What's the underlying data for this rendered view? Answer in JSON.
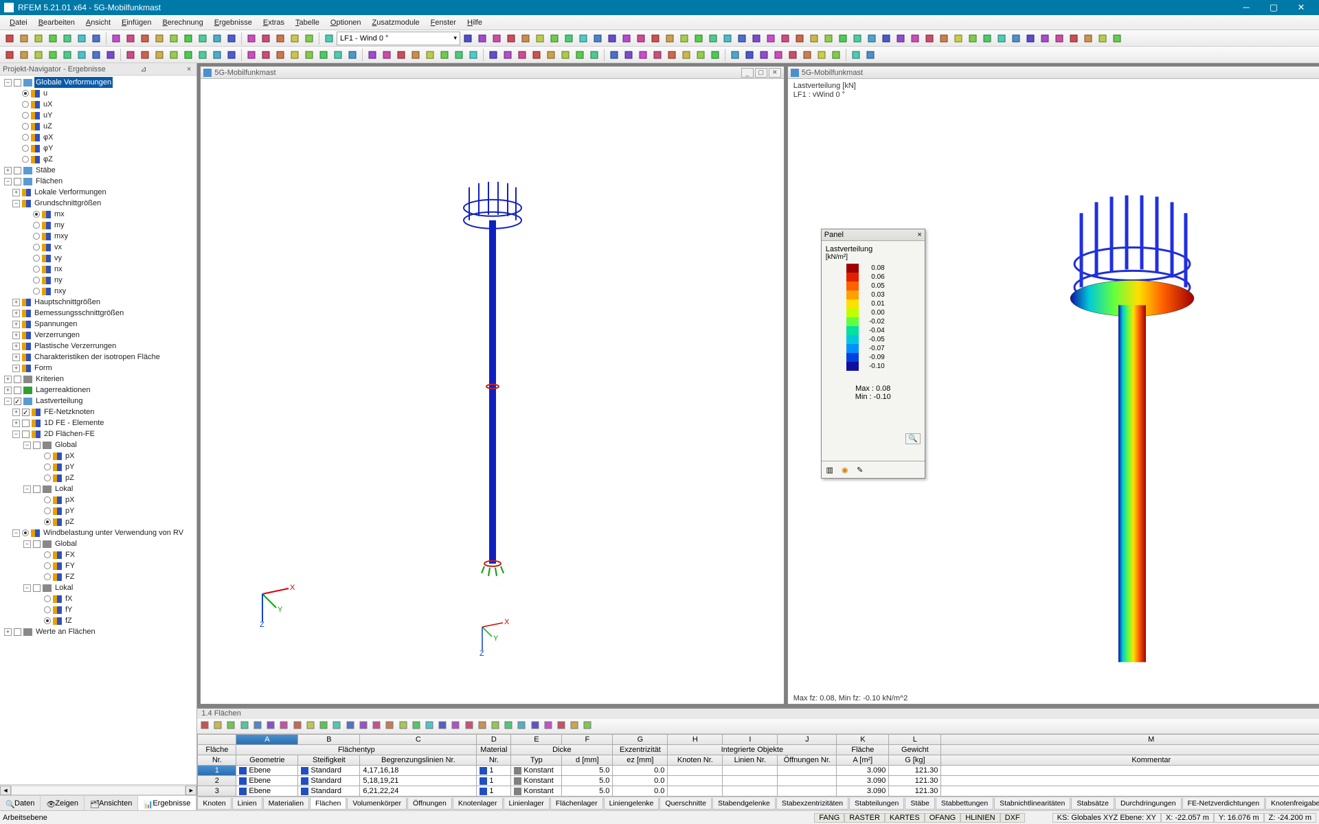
{
  "app": {
    "title": "RFEM 5.21.01 x64 - 5G-Mobilfunkmast"
  },
  "menu": [
    "Datei",
    "Bearbeiten",
    "Ansicht",
    "Einfügen",
    "Berechnung",
    "Ergebnisse",
    "Extras",
    "Tabelle",
    "Optionen",
    "Zusatzmodule",
    "Fenster",
    "Hilfe"
  ],
  "loadcase_combo": "LF1 - Wind 0 °",
  "navigator": {
    "title": "Projekt-Navigator - Ergebnisse",
    "tabs": [
      "Daten",
      "Zeigen",
      "Ansichten",
      "Ergebnisse"
    ],
    "active_tab": 3,
    "tree": {
      "root": "Globale Verformungen",
      "glob_items": [
        "u",
        "uX",
        "uY",
        "uZ",
        "φX",
        "φY",
        "φZ"
      ],
      "staebe": "Stäbe",
      "flaechen": "Flächen",
      "lokale_verf": "Lokale Verformungen",
      "grundschnitt": "Grundschnittgrößen",
      "gs_items": [
        "mx",
        "my",
        "mxy",
        "vx",
        "vy",
        "nx",
        "ny",
        "nxy"
      ],
      "hauptschnitt": "Hauptschnittgrößen",
      "bemessungsschnitt": "Bemessungsschnittgrößen",
      "spannungen": "Spannungen",
      "verzerrungen": "Verzerrungen",
      "plastische": "Plastische Verzerrungen",
      "charakteristiken": "Charakteristiken der isotropen Fläche",
      "form": "Form",
      "kriterien": "Kriterien",
      "lagerreaktionen": "Lagerreaktionen",
      "lastverteilung": "Lastverteilung",
      "fe_netzknoten": "FE-Netzknoten",
      "fe_1d": "1D FE - Elemente",
      "fe_2d": "2D Flächen-FE",
      "global": "Global",
      "px": "pX",
      "py": "pY",
      "pz": "pZ",
      "lokal": "Lokal",
      "windlast": "Windbelastung unter Verwendung von RV",
      "fx": "FX",
      "fy": "FY",
      "fz": "FZ",
      "lfx": "fX",
      "lfy": "fY",
      "lfz": "fZ",
      "werte": "Werte an Flächen"
    }
  },
  "view1": {
    "title": "5G-Mobilfunkmast"
  },
  "view2": {
    "title": "5G-Mobilfunkmast",
    "info_l1": "Lastverteilung [kN]",
    "info_l2": "LF1 : vWind 0 °",
    "foot": "Max fz: 0.08, Min fz: -0.10 kN/m^2"
  },
  "legend": {
    "title": "Panel",
    "heading": "Lastverteilung",
    "unit": "[kN/m²]",
    "values": [
      "0.08",
      "0.06",
      "0.05",
      "0.03",
      "0.01",
      "0.00",
      "-0.02",
      "-0.04",
      "-0.05",
      "-0.07",
      "-0.09",
      "-0.10"
    ],
    "colors": [
      "#a00000",
      "#e02000",
      "#ff6000",
      "#ffa000",
      "#ffe000",
      "#c0ff00",
      "#60ff40",
      "#00e0a0",
      "#00c8d8",
      "#0090ff",
      "#0040e0",
      "#1010a0"
    ],
    "max": "Max  :   0.08",
    "min": "Min   :  -0.10"
  },
  "table": {
    "title": "1.4 Flächen",
    "col_letters": [
      "A",
      "B",
      "C",
      "D",
      "E",
      "F",
      "G",
      "H",
      "I",
      "J",
      "K",
      "L",
      "M"
    ],
    "group_row1": {
      "flaeche_nr": "Fläche",
      "flaechentyp": "Flächentyp",
      "material_nr": "Material",
      "dicke": "Dicke",
      "exz": "Exzentrizität",
      "intobj": "Integrierte Objekte",
      "flaeche": "Fläche",
      "gewicht": "Gewicht",
      "kommentar": ""
    },
    "group_row2": {
      "nr": "Nr.",
      "geometrie": "Geometrie",
      "steifigkeit": "Steifigkeit",
      "begrenz": "Begrenzungslinien Nr.",
      "mat_nr": "Nr.",
      "typ": "Typ",
      "d": "d [mm]",
      "ez": "ez [mm]",
      "knoten": "Knoten Nr.",
      "linien": "Linien Nr.",
      "oeffnungen": "Öffnungen Nr.",
      "a": "A [m²]",
      "g": "G [kg]",
      "komm": "Kommentar"
    },
    "rows": [
      {
        "nr": "1",
        "geom": "Ebene",
        "steif": "Standard",
        "begr": "4,17,16,18",
        "mat": "1",
        "typ": "Konstant",
        "d": "5.0",
        "ez": "0.0",
        "a": "3.090",
        "g": "121.30"
      },
      {
        "nr": "2",
        "geom": "Ebene",
        "steif": "Standard",
        "begr": "5,18,19,21",
        "mat": "1",
        "typ": "Konstant",
        "d": "5.0",
        "ez": "0.0",
        "a": "3.090",
        "g": "121.30"
      },
      {
        "nr": "3",
        "geom": "Ebene",
        "steif": "Standard",
        "begr": "6,21,22,24",
        "mat": "1",
        "typ": "Konstant",
        "d": "5.0",
        "ez": "0.0",
        "a": "3.090",
        "g": "121.30"
      }
    ],
    "bottom_tabs": [
      "Knoten",
      "Linien",
      "Materialien",
      "Flächen",
      "Volumenkörper",
      "Öffnungen",
      "Knotenlager",
      "Linienlager",
      "Flächenlager",
      "Liniengelenke",
      "Querschnitte",
      "Stabendgelenke",
      "Stabexzentrizitäten",
      "Stabteilungen",
      "Stäbe",
      "Stabbettungen",
      "Stabnichtlinearitäten",
      "Stabsätze",
      "Durchdringungen",
      "FE-Netzverdichtungen",
      "Knotenfreigaben"
    ],
    "active_btab": 3
  },
  "status": {
    "left": "Arbeitsebene",
    "snaps": [
      "FANG",
      "RASTER",
      "KARTES",
      "OFANG",
      "HLINIEN",
      "DXF"
    ],
    "cs": "KS: Globales XYZ  Ebene: XY",
    "x": "X:  -22.057 m",
    "y": "Y:   16.076 m",
    "z": "Z:   -24.200 m"
  }
}
